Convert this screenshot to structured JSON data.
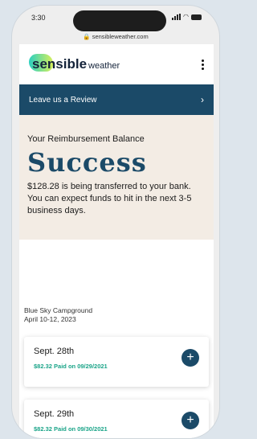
{
  "status_bar": {
    "time": "3:30"
  },
  "browser": {
    "url": "sensibleweather.com"
  },
  "header": {
    "brand_word1": "sensible",
    "brand_word2": "weather"
  },
  "review_banner": {
    "label": "Leave us a Review",
    "chevron": "›"
  },
  "balance": {
    "title": "Your Reimbursement Balance",
    "status": "Success",
    "message": "$128.28 is being transferred to your bank. You can expect funds to hit in the next 3-5 business days."
  },
  "campground": {
    "name": "Blue Sky Campground",
    "dates": "April 10-12, 2023"
  },
  "days": [
    {
      "date": "Sept. 28th",
      "paid": "$82.32 Paid on 09/29/2021"
    },
    {
      "date": "Sept. 29th",
      "paid": "$82.32 Paid on 09/30/2021"
    }
  ],
  "colors": {
    "navy": "#1b4a68",
    "paid_green": "#1aa488",
    "balance_bg": "#f3ece4"
  },
  "icons": {
    "lock": "lock-icon",
    "plus": "plus-icon",
    "chevron": "chevron-right-icon"
  }
}
